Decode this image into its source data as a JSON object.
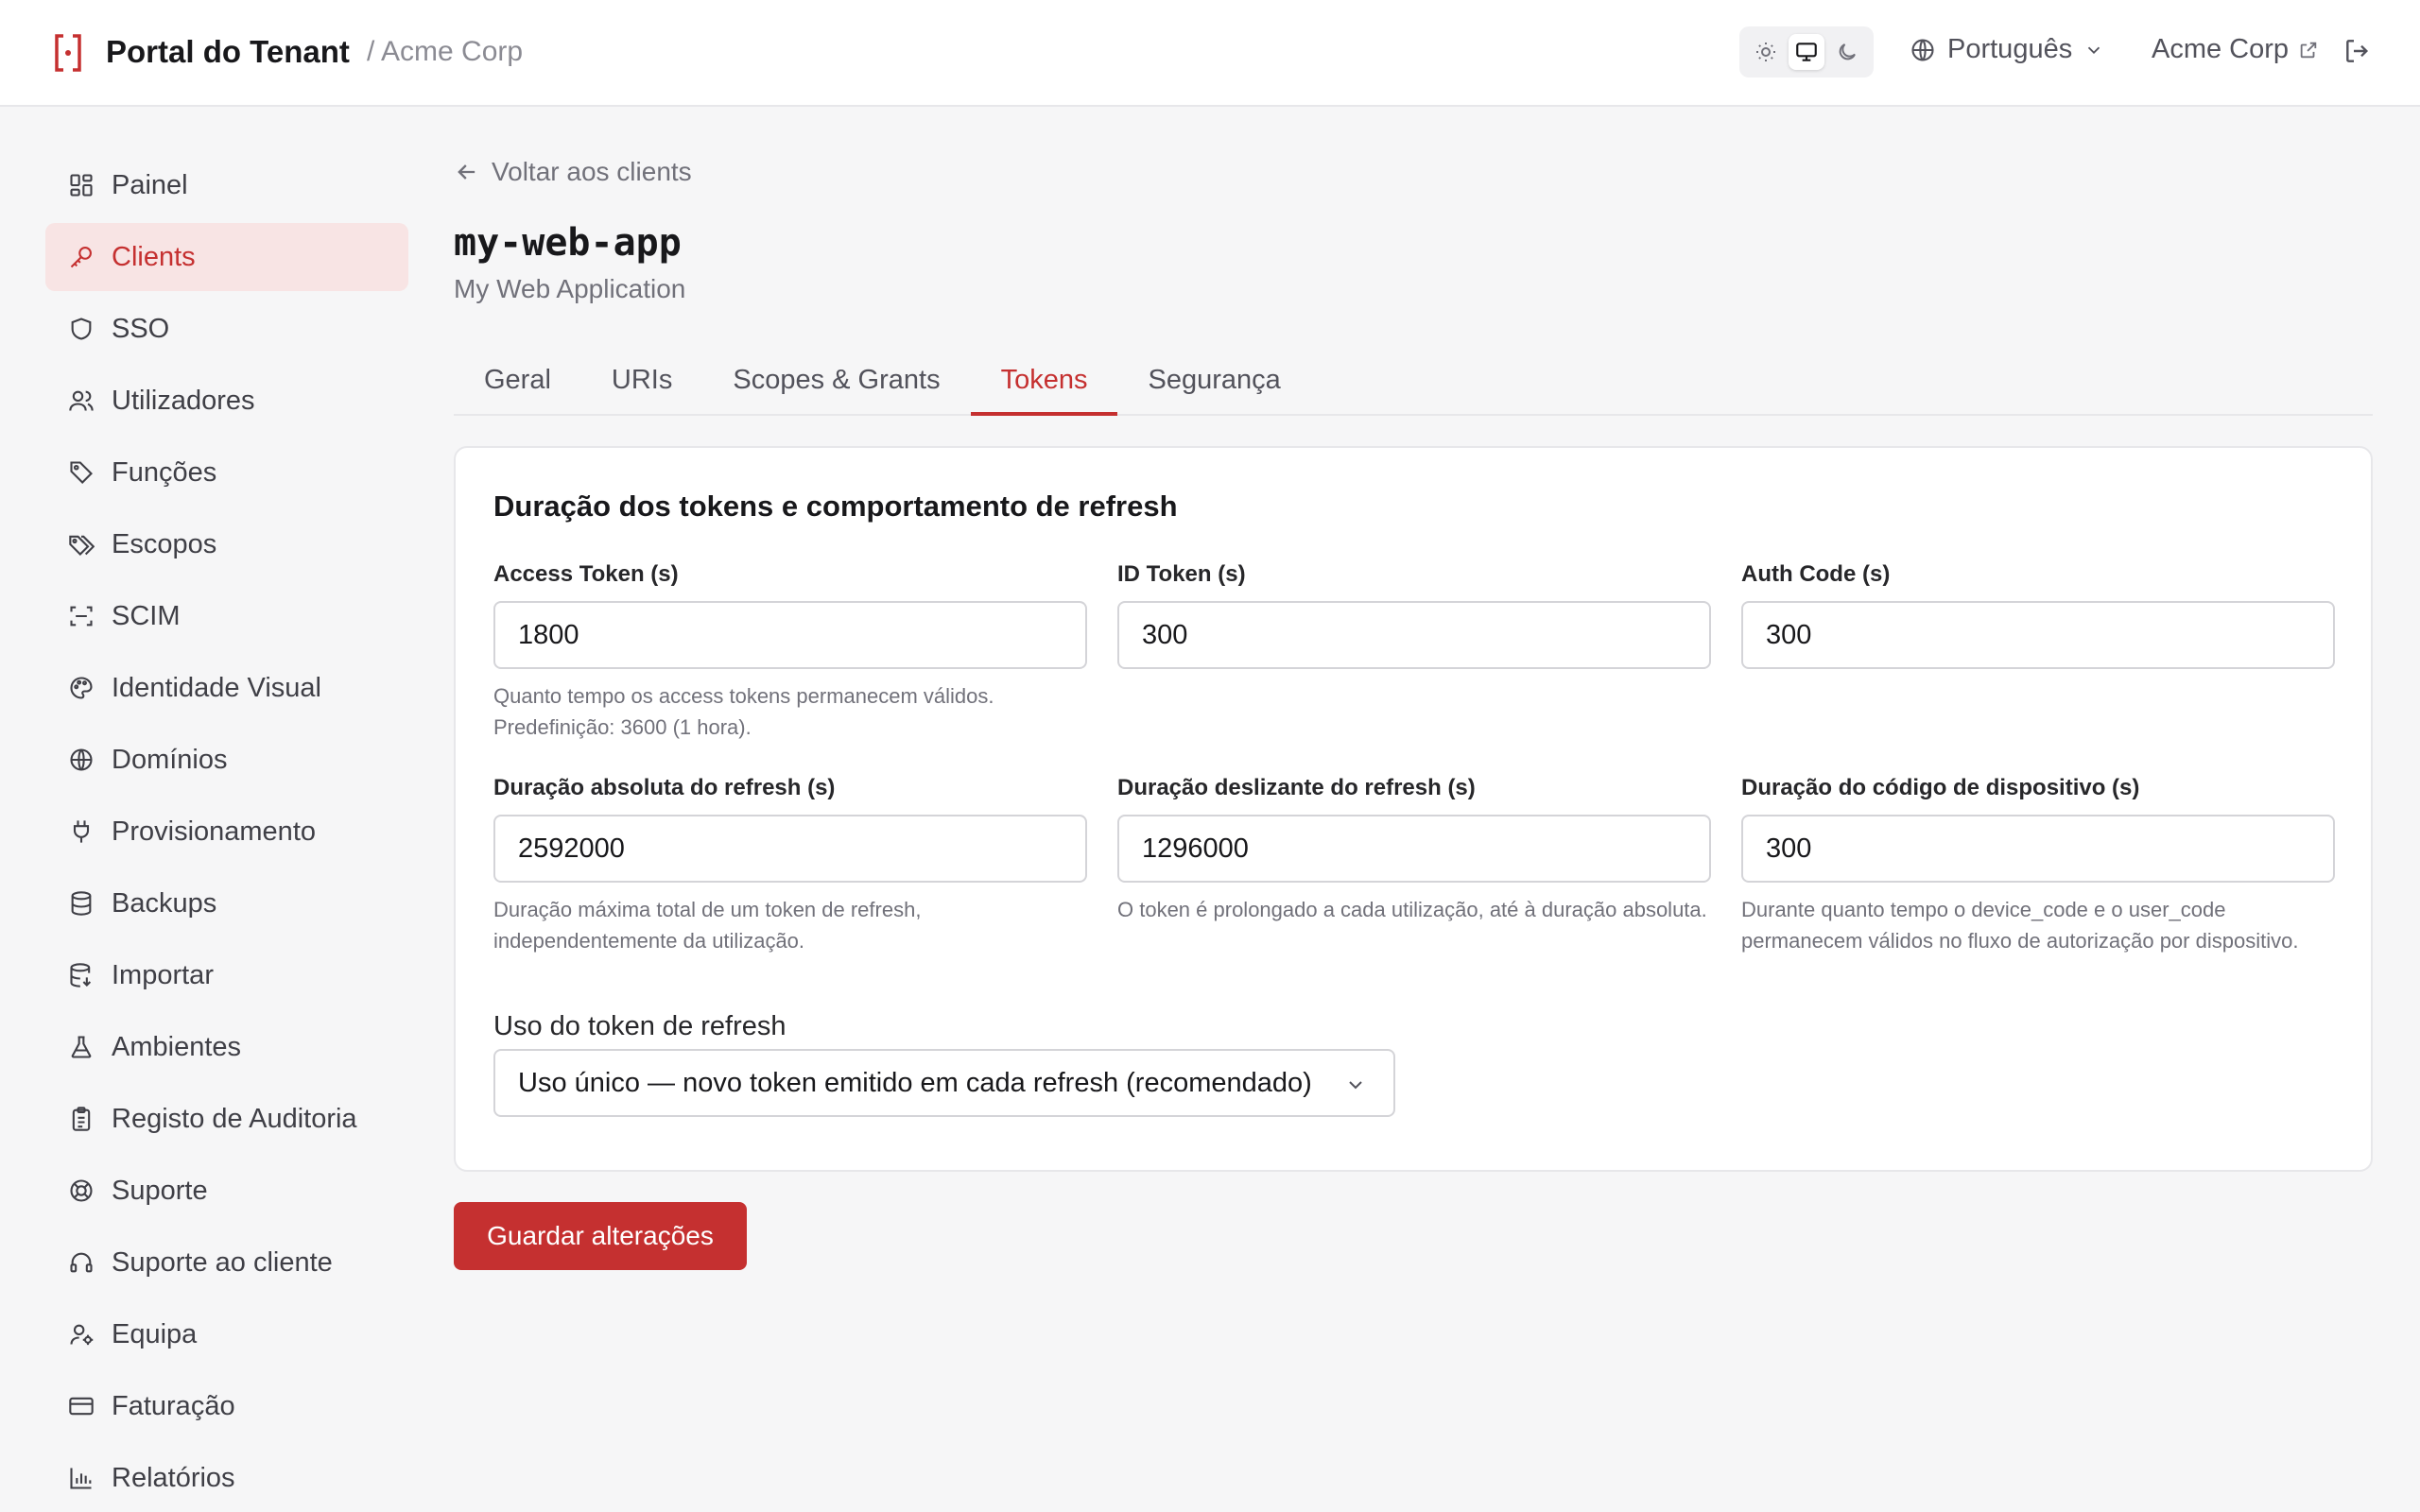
{
  "header": {
    "title": "Portal do Tenant",
    "tenant_crumb": "/ Acme Corp",
    "language": "Português",
    "tenant_link": "Acme Corp",
    "accent_color": "#c53030"
  },
  "sidebar": {
    "items": [
      {
        "label": "Painel",
        "icon": "dashboard-icon"
      },
      {
        "label": "Clients",
        "icon": "key-icon",
        "active": true
      },
      {
        "label": "SSO",
        "icon": "shield-icon"
      },
      {
        "label": "Utilizadores",
        "icon": "users-icon"
      },
      {
        "label": "Funções",
        "icon": "tag-icon"
      },
      {
        "label": "Escopos",
        "icon": "tags-icon"
      },
      {
        "label": "SCIM",
        "icon": "scan-icon"
      },
      {
        "label": "Identidade Visual",
        "icon": "palette-icon"
      },
      {
        "label": "Domínios",
        "icon": "globe-icon"
      },
      {
        "label": "Provisionamento",
        "icon": "plug-icon"
      },
      {
        "label": "Backups",
        "icon": "database-icon"
      },
      {
        "label": "Importar",
        "icon": "database-import-icon"
      },
      {
        "label": "Ambientes",
        "icon": "flask-icon"
      },
      {
        "label": "Registo de Auditoria",
        "icon": "clipboard-icon"
      },
      {
        "label": "Suporte",
        "icon": "lifebuoy-icon"
      },
      {
        "label": "Suporte ao cliente",
        "icon": "headset-icon"
      },
      {
        "label": "Equipa",
        "icon": "user-gear-icon"
      },
      {
        "label": "Faturação",
        "icon": "credit-card-icon"
      },
      {
        "label": "Relatórios",
        "icon": "bar-chart-icon"
      }
    ]
  },
  "main": {
    "back_label": "Voltar aos clients",
    "client_id": "my-web-app",
    "client_name": "My Web Application",
    "tabs": [
      {
        "label": "Geral"
      },
      {
        "label": "URIs"
      },
      {
        "label": "Scopes & Grants"
      },
      {
        "label": "Tokens",
        "active": true
      },
      {
        "label": "Segurança"
      }
    ],
    "card": {
      "title": "Duração dos tokens e comportamento de refresh",
      "fields": [
        {
          "label": "Access Token (s)",
          "value": "1800",
          "help": "Quanto tempo os access tokens permanecem válidos. Predefinição: 3600 (1 hora)."
        },
        {
          "label": "ID Token (s)",
          "value": "300",
          "help": ""
        },
        {
          "label": "Auth Code (s)",
          "value": "300",
          "help": ""
        },
        {
          "label": "Duração absoluta do refresh (s)",
          "value": "2592000",
          "help": "Duração máxima total de um token de refresh, independentemente da utilização."
        },
        {
          "label": "Duração deslizante do refresh (s)",
          "value": "1296000",
          "help": "O token é prolongado a cada utilização, até à duração absoluta."
        },
        {
          "label": "Duração do código de dispositivo (s)",
          "value": "300",
          "help": "Durante quanto tempo o device_code e o user_code permanecem válidos no fluxo de autorização por dispositivo."
        }
      ],
      "refresh_usage_label": "Uso do token de refresh",
      "refresh_usage_value": "Uso único — novo token emitido em cada refresh (recomendado)"
    },
    "save_label": "Guardar alterações"
  }
}
